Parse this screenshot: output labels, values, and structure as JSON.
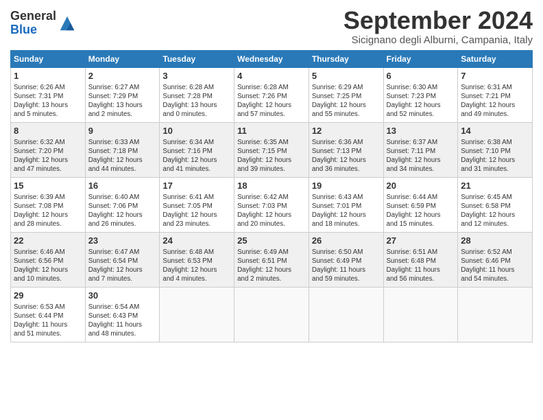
{
  "header": {
    "logo_line1": "General",
    "logo_line2": "Blue",
    "month_title": "September 2024",
    "subtitle": "Sicignano degli Alburni, Campania, Italy"
  },
  "weekdays": [
    "Sunday",
    "Monday",
    "Tuesday",
    "Wednesday",
    "Thursday",
    "Friday",
    "Saturday"
  ],
  "weeks": [
    [
      {
        "day": "1",
        "info": "Sunrise: 6:26 AM\nSunset: 7:31 PM\nDaylight: 13 hours\nand 5 minutes."
      },
      {
        "day": "2",
        "info": "Sunrise: 6:27 AM\nSunset: 7:29 PM\nDaylight: 13 hours\nand 2 minutes."
      },
      {
        "day": "3",
        "info": "Sunrise: 6:28 AM\nSunset: 7:28 PM\nDaylight: 13 hours\nand 0 minutes."
      },
      {
        "day": "4",
        "info": "Sunrise: 6:28 AM\nSunset: 7:26 PM\nDaylight: 12 hours\nand 57 minutes."
      },
      {
        "day": "5",
        "info": "Sunrise: 6:29 AM\nSunset: 7:25 PM\nDaylight: 12 hours\nand 55 minutes."
      },
      {
        "day": "6",
        "info": "Sunrise: 6:30 AM\nSunset: 7:23 PM\nDaylight: 12 hours\nand 52 minutes."
      },
      {
        "day": "7",
        "info": "Sunrise: 6:31 AM\nSunset: 7:21 PM\nDaylight: 12 hours\nand 49 minutes."
      }
    ],
    [
      {
        "day": "8",
        "info": "Sunrise: 6:32 AM\nSunset: 7:20 PM\nDaylight: 12 hours\nand 47 minutes."
      },
      {
        "day": "9",
        "info": "Sunrise: 6:33 AM\nSunset: 7:18 PM\nDaylight: 12 hours\nand 44 minutes."
      },
      {
        "day": "10",
        "info": "Sunrise: 6:34 AM\nSunset: 7:16 PM\nDaylight: 12 hours\nand 41 minutes."
      },
      {
        "day": "11",
        "info": "Sunrise: 6:35 AM\nSunset: 7:15 PM\nDaylight: 12 hours\nand 39 minutes."
      },
      {
        "day": "12",
        "info": "Sunrise: 6:36 AM\nSunset: 7:13 PM\nDaylight: 12 hours\nand 36 minutes."
      },
      {
        "day": "13",
        "info": "Sunrise: 6:37 AM\nSunset: 7:11 PM\nDaylight: 12 hours\nand 34 minutes."
      },
      {
        "day": "14",
        "info": "Sunrise: 6:38 AM\nSunset: 7:10 PM\nDaylight: 12 hours\nand 31 minutes."
      }
    ],
    [
      {
        "day": "15",
        "info": "Sunrise: 6:39 AM\nSunset: 7:08 PM\nDaylight: 12 hours\nand 28 minutes."
      },
      {
        "day": "16",
        "info": "Sunrise: 6:40 AM\nSunset: 7:06 PM\nDaylight: 12 hours\nand 26 minutes."
      },
      {
        "day": "17",
        "info": "Sunrise: 6:41 AM\nSunset: 7:05 PM\nDaylight: 12 hours\nand 23 minutes."
      },
      {
        "day": "18",
        "info": "Sunrise: 6:42 AM\nSunset: 7:03 PM\nDaylight: 12 hours\nand 20 minutes."
      },
      {
        "day": "19",
        "info": "Sunrise: 6:43 AM\nSunset: 7:01 PM\nDaylight: 12 hours\nand 18 minutes."
      },
      {
        "day": "20",
        "info": "Sunrise: 6:44 AM\nSunset: 6:59 PM\nDaylight: 12 hours\nand 15 minutes."
      },
      {
        "day": "21",
        "info": "Sunrise: 6:45 AM\nSunset: 6:58 PM\nDaylight: 12 hours\nand 12 minutes."
      }
    ],
    [
      {
        "day": "22",
        "info": "Sunrise: 6:46 AM\nSunset: 6:56 PM\nDaylight: 12 hours\nand 10 minutes."
      },
      {
        "day": "23",
        "info": "Sunrise: 6:47 AM\nSunset: 6:54 PM\nDaylight: 12 hours\nand 7 minutes."
      },
      {
        "day": "24",
        "info": "Sunrise: 6:48 AM\nSunset: 6:53 PM\nDaylight: 12 hours\nand 4 minutes."
      },
      {
        "day": "25",
        "info": "Sunrise: 6:49 AM\nSunset: 6:51 PM\nDaylight: 12 hours\nand 2 minutes."
      },
      {
        "day": "26",
        "info": "Sunrise: 6:50 AM\nSunset: 6:49 PM\nDaylight: 11 hours\nand 59 minutes."
      },
      {
        "day": "27",
        "info": "Sunrise: 6:51 AM\nSunset: 6:48 PM\nDaylight: 11 hours\nand 56 minutes."
      },
      {
        "day": "28",
        "info": "Sunrise: 6:52 AM\nSunset: 6:46 PM\nDaylight: 11 hours\nand 54 minutes."
      }
    ],
    [
      {
        "day": "29",
        "info": "Sunrise: 6:53 AM\nSunset: 6:44 PM\nDaylight: 11 hours\nand 51 minutes."
      },
      {
        "day": "30",
        "info": "Sunrise: 6:54 AM\nSunset: 6:43 PM\nDaylight: 11 hours\nand 48 minutes."
      },
      {
        "day": "",
        "info": ""
      },
      {
        "day": "",
        "info": ""
      },
      {
        "day": "",
        "info": ""
      },
      {
        "day": "",
        "info": ""
      },
      {
        "day": "",
        "info": ""
      }
    ]
  ]
}
